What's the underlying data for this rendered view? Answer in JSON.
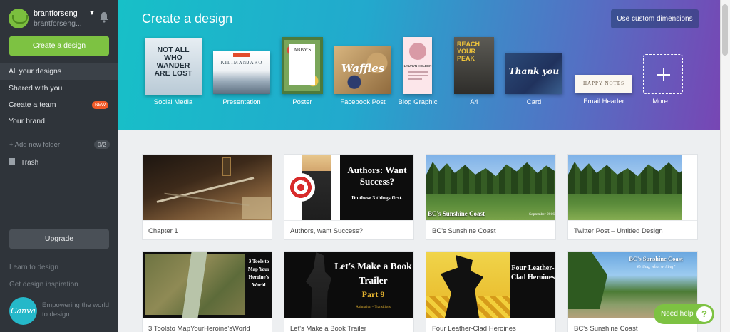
{
  "sidebar": {
    "username": "brantforseng",
    "username_sub": "brantforseng...",
    "create_button": "Create a design",
    "items": [
      {
        "label": "All your designs"
      },
      {
        "label": "Shared with you"
      },
      {
        "label": "Create a team",
        "badge": "NEW"
      },
      {
        "label": "Your brand"
      }
    ],
    "add_folder": "+ Add new folder",
    "folder_count": "0/2",
    "trash": "Trash",
    "upgrade": "Upgrade",
    "learn": "Learn to design",
    "inspiration": "Get design inspiration",
    "logo_text": "Canva",
    "tagline": "Empowering the world to design",
    "accent": "#7dc242"
  },
  "header": {
    "title": "Create a design",
    "custom_button": "Use custom dimensions",
    "templates": [
      {
        "label": "Social Media",
        "thumb_text": "NOT ALL WHO WANDER ARE LOST"
      },
      {
        "label": "Presentation",
        "thumb_text": "KILIMANJARO"
      },
      {
        "label": "Poster",
        "thumb_text": "ABBY'S"
      },
      {
        "label": "Facebook Post",
        "thumb_text": "Waffles"
      },
      {
        "label": "Blog Graphic",
        "thumb_text": "LAURYN HOLDEN"
      },
      {
        "label": "A4",
        "thumb_text": "REACH YOUR PEAK"
      },
      {
        "label": "Card",
        "thumb_text": "Thank you"
      },
      {
        "label": "Email Header",
        "thumb_text": "HAPPY NOTES"
      },
      {
        "label": "More..."
      }
    ]
  },
  "designs": [
    {
      "caption": "Chapter 1"
    },
    {
      "caption": "Authors, want Success?",
      "img_title": "Authors: Want Success?",
      "img_sub": "Do these 3 things first."
    },
    {
      "caption": "BC's Sunshine Coast",
      "img_title": "BC's Sunshine Coast",
      "img_sub": "September 2016"
    },
    {
      "caption": "Twitter Post – Untitled Design"
    },
    {
      "caption": "3 Toolsto MapYourHeroine'sWorld",
      "img_title": "3 Tools to Map Your Heroine's World"
    },
    {
      "caption": "Let's Make a Book Trailer",
      "img_title": "Let's Make a Book Trailer",
      "img_sub": "Part 9",
      "img_sub2": "Animation – Transitions"
    },
    {
      "caption": "Four Leather-Clad Heroines",
      "img_title": "Four Leather-Clad Heroines"
    },
    {
      "caption": "BC's Sunshine Coast",
      "img_title": "BC's Sunshine Coast",
      "img_sub": "Writing, what writing?"
    }
  ],
  "help": {
    "label": "Need help",
    "icon": "?"
  }
}
